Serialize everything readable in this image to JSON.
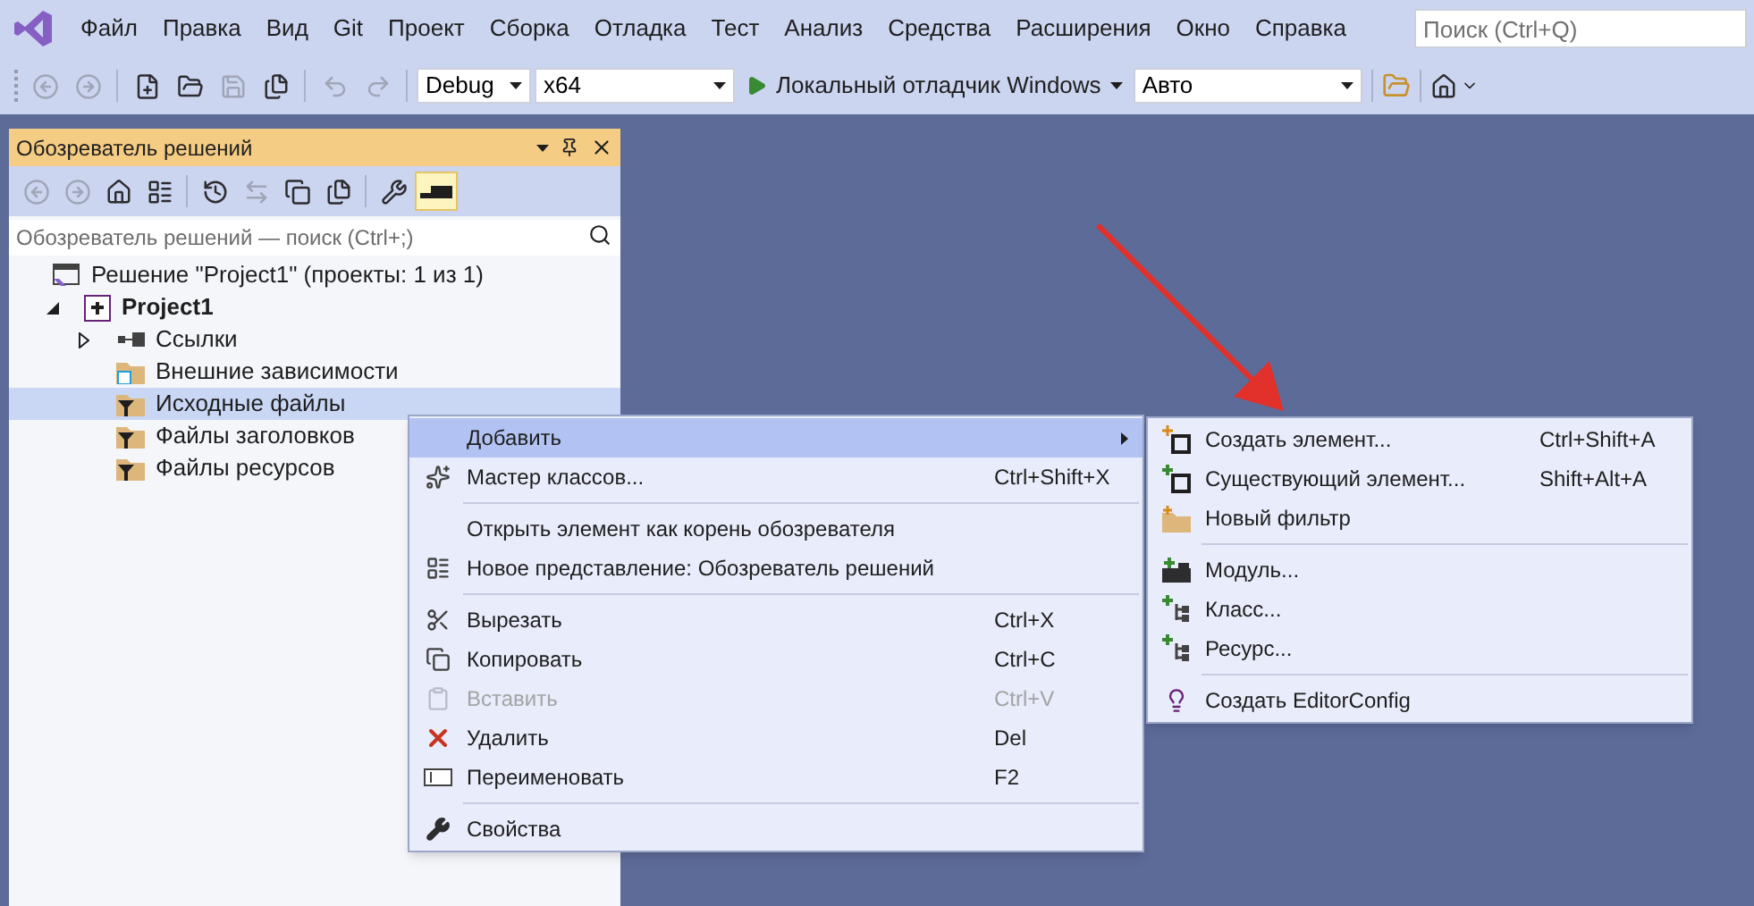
{
  "menu_bar": {
    "items": [
      "Файл",
      "Правка",
      "Вид",
      "Git",
      "Проект",
      "Сборка",
      "Отладка",
      "Тест",
      "Анализ",
      "Средства",
      "Расширения",
      "Окно",
      "Справка"
    ],
    "search": {
      "placeholder": "Поиск (Ctrl+Q)"
    }
  },
  "toolbar": {
    "buttons": [
      {
        "kind": "back",
        "disabled": true
      },
      {
        "kind": "forward",
        "disabled": true
      },
      {
        "kind": "new",
        "disabled": false
      },
      {
        "kind": "open",
        "disabled": false
      },
      {
        "kind": "save",
        "disabled": true
      },
      {
        "kind": "save-all",
        "disabled": false
      },
      {
        "kind": "undo",
        "disabled": true
      },
      {
        "kind": "redo",
        "disabled": true
      }
    ],
    "configuration": "Debug",
    "platform": "x64",
    "run": "Локальный отладчик Windows",
    "target": "Авто"
  },
  "solution_explorer": {
    "title": "Обозреватель решений",
    "buttons": [
      {
        "kind": "back",
        "selected": false,
        "disabled": true
      },
      {
        "kind": "forward",
        "selected": false,
        "disabled": true
      },
      {
        "kind": "home",
        "selected": false,
        "disabled": false
      },
      {
        "kind": "switch",
        "selected": false,
        "disabled": false
      },
      {
        "kind": "history",
        "selected": false,
        "disabled": false
      },
      {
        "kind": "sync",
        "selected": false,
        "disabled": true
      },
      {
        "kind": "collapse",
        "selected": false,
        "disabled": false
      },
      {
        "kind": "copy",
        "selected": false,
        "disabled": false
      },
      {
        "kind": "properties",
        "selected": false,
        "disabled": false
      },
      {
        "kind": "preview",
        "selected": true,
        "disabled": false
      }
    ],
    "search": {
      "placeholder": "Обозреватель решений — поиск (Ctrl+;)"
    },
    "tree": [
      {
        "label": "Решение \"Project1\" (проекты: 1 из 1)",
        "kind": "solution",
        "selected": false,
        "children": [
          {
            "label": "Project1",
            "kind": "project",
            "expanded": true,
            "selected": false,
            "children": [
              {
                "label": "Ссылки",
                "kind": "references",
                "expanded": false,
                "selected": false
              },
              {
                "label": "Внешние зависимости",
                "kind": "external",
                "selected": false
              },
              {
                "label": "Исходные файлы",
                "kind": "filter",
                "selected": true
              },
              {
                "label": "Файлы заголовков",
                "kind": "filter",
                "selected": false
              },
              {
                "label": "Файлы ресурсов",
                "kind": "filter",
                "selected": false
              }
            ]
          }
        ]
      }
    ]
  },
  "context_menu": {
    "items": [
      {
        "kind": "item",
        "label": "Добавить",
        "submenu": true,
        "selected": true,
        "disabled": false
      },
      {
        "kind": "item",
        "label": "Мастер классов...",
        "shortcut": "Ctrl+Shift+X",
        "selected": false,
        "disabled": false
      },
      {
        "kind": "separator"
      },
      {
        "kind": "item",
        "label": "Открыть элемент как корень обозревателя",
        "selected": false,
        "disabled": false
      },
      {
        "kind": "item",
        "label": "Новое представление: Обозреватель решений",
        "selected": false,
        "disabled": false
      },
      {
        "kind": "separator"
      },
      {
        "kind": "item",
        "label": "Вырезать",
        "shortcut": "Ctrl+X",
        "selected": false,
        "disabled": false
      },
      {
        "kind": "item",
        "label": "Копировать",
        "shortcut": "Ctrl+C",
        "selected": false,
        "disabled": false
      },
      {
        "kind": "item",
        "label": "Вставить",
        "shortcut": "Ctrl+V",
        "selected": false,
        "disabled": true
      },
      {
        "kind": "item",
        "label": "Удалить",
        "shortcut": "Del",
        "selected": false,
        "disabled": false
      },
      {
        "kind": "item",
        "label": "Переименовать",
        "shortcut": "F2",
        "selected": false,
        "disabled": false
      },
      {
        "kind": "separator"
      },
      {
        "kind": "item",
        "label": "Свойства",
        "selected": false,
        "disabled": false
      }
    ]
  },
  "submenu": {
    "items": [
      {
        "kind": "item",
        "label": "Создать элемент...",
        "shortcut": "Ctrl+Shift+A"
      },
      {
        "kind": "item",
        "label": "Существующий элемент...",
        "shortcut": "Shift+Alt+A"
      },
      {
        "kind": "item",
        "label": "Новый фильтр"
      },
      {
        "kind": "separator"
      },
      {
        "kind": "item",
        "label": "Модуль..."
      },
      {
        "kind": "item",
        "label": "Класс..."
      },
      {
        "kind": "item",
        "label": "Ресурс..."
      },
      {
        "kind": "separator"
      },
      {
        "kind": "item",
        "label": "Создать EditorConfig"
      }
    ]
  }
}
